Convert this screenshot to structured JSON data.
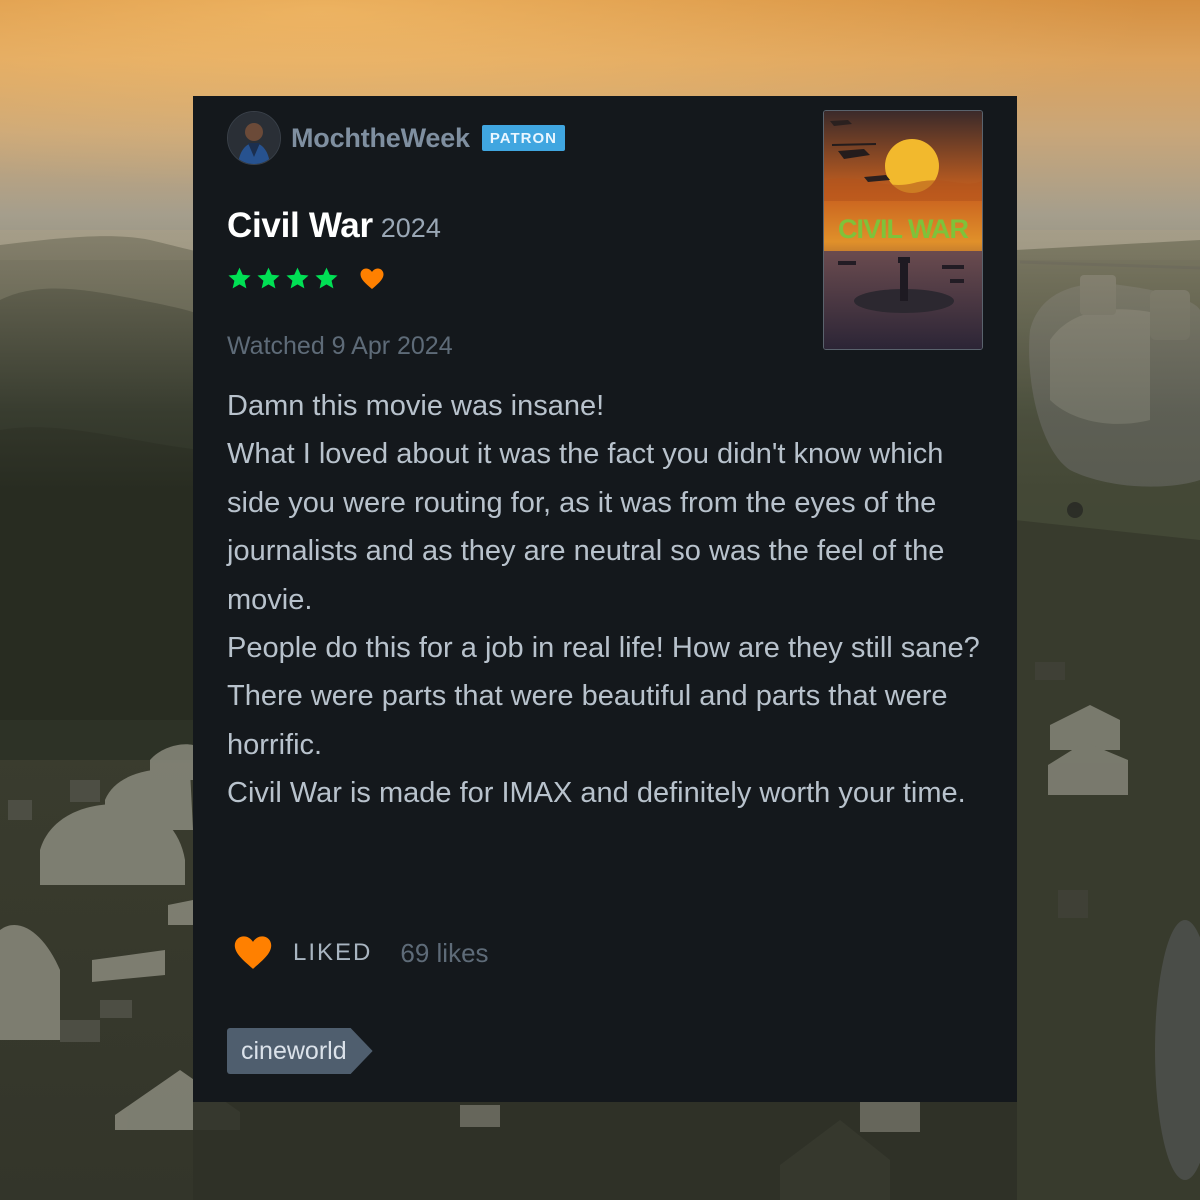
{
  "review": {
    "username": "MochtheWeek",
    "badge": "PATRON",
    "film_title": "Civil War",
    "film_year": "2024",
    "rating_stars": 4,
    "liked_heart": true,
    "watched": "Watched 9 Apr 2024",
    "body_lines": [
      "Damn this movie was insane!",
      "What I loved about it was the fact you didn't know which side you were routing for, as it was from the eyes of the journalists and as they are neutral so was the feel of the movie.",
      "People do this for a job in real life! How are they still sane?",
      "There were parts that were beautiful and parts that were horrific.",
      "Civil War is made for IMAX and definitely worth your time."
    ],
    "liked_label": "LIKED",
    "likes_count": "69 likes",
    "tag": "cineworld",
    "poster_text": "CIVIL WAR"
  },
  "colors": {
    "card_bg": "#14181c",
    "star_green": "#00e054",
    "heart_orange": "#ff8000",
    "badge_blue": "#40a6e0"
  },
  "icons": {
    "star": "star-icon",
    "heart": "heart-icon"
  }
}
